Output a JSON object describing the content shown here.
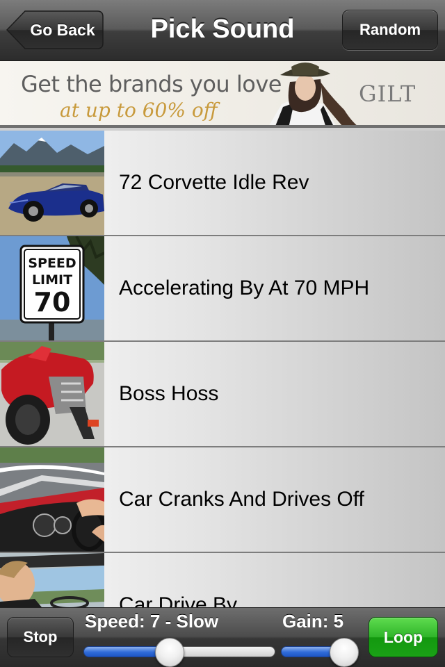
{
  "navbar": {
    "back_label": "Go Back",
    "title": "Pick Sound",
    "random_label": "Random"
  },
  "ad": {
    "line1": "Get the brands you love",
    "line2": "at up to 60% off",
    "brand": "GILT",
    "accent_color": "#c89a3c"
  },
  "sounds": [
    {
      "label": "72 Corvette Idle Rev",
      "thumb": "blue-corvette-mountains"
    },
    {
      "label": "Accelerating By At 70 MPH",
      "thumb": "speed-limit-70-sign",
      "sign_text": [
        "SPEED",
        "LIMIT",
        "70"
      ]
    },
    {
      "label": "Boss Hoss",
      "thumb": "red-boss-hoss-motorcycle"
    },
    {
      "label": "Car Cranks And Drives Off",
      "thumb": "red-convertible-dashboard"
    },
    {
      "label": "Car Drive By",
      "thumb": "driver-behind-windshield"
    }
  ],
  "toolbar": {
    "stop_label": "Stop",
    "speed_label": "Speed: 7 - Slow",
    "gain_label": "Gain: 5",
    "loop_label": "Loop",
    "speed_fraction": 0.45,
    "gain_fraction": 0.82,
    "loop_color": "#2fb52a",
    "slider_fill_color": "#2f6bd8"
  }
}
